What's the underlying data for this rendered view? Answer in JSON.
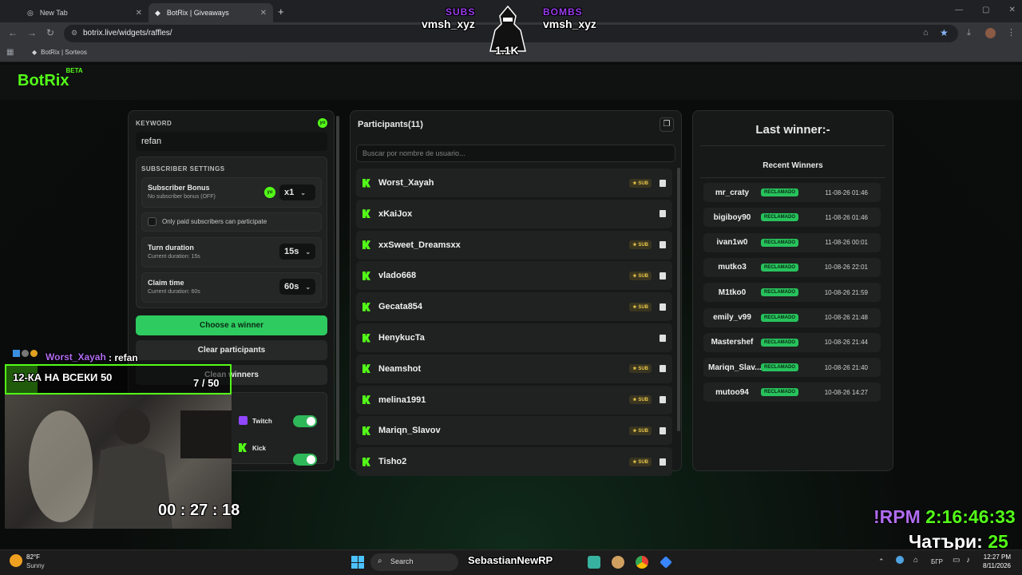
{
  "browser": {
    "tabs": [
      {
        "label": "New Tab"
      },
      {
        "label": "BotRix | Giveaways"
      }
    ],
    "url": "botrix.live/widgets/raffles/",
    "bookmark": "BotRix | Sorteos"
  },
  "overlay_top": {
    "subs_label": "SUBS",
    "subs_name": "vmsh_xyz",
    "bombs_label": "BOMBS",
    "bombs_name": "vmsh_xyz",
    "count": "1.1K"
  },
  "app": {
    "logo": "BotRix",
    "beta": "BETA"
  },
  "settings": {
    "keyword_label": "KEYWORD",
    "keyword_value": "refan",
    "sub_settings_label": "SUBSCRIBER SETTINGS",
    "bonus_title": "Subscriber Bonus",
    "bonus_sub": "No subscriber bonus (OFF)",
    "bonus_value": "x1",
    "paid_only": "Only paid subscribers can participate",
    "turn_title": "Turn duration",
    "turn_sub": "Current duration: 15s",
    "turn_value": "15s",
    "claim_title": "Claim time",
    "claim_sub": "Current duration: 60s",
    "claim_value": "60s",
    "choose_btn": "Choose a winner",
    "clear_participants_btn": "Clear participants",
    "clear_winners_btn": "Clean winners",
    "twitch": "Twitch",
    "kick": "Kick"
  },
  "participants": {
    "title": "Participants(11)",
    "search_placeholder": "Buscar por nombre de usuario...",
    "sub_badge": "SUB",
    "rows": [
      {
        "name": "Worst_Xayah",
        "sub": true
      },
      {
        "name": "xKaiJox",
        "sub": false
      },
      {
        "name": "xxSweet_Dreamsxx",
        "sub": true
      },
      {
        "name": "vlado668",
        "sub": true
      },
      {
        "name": "Gecata854",
        "sub": true
      },
      {
        "name": "HenykucTa",
        "sub": false
      },
      {
        "name": "Neamshot",
        "sub": true
      },
      {
        "name": "melina1991",
        "sub": true
      },
      {
        "name": "Mariqn_Slavov",
        "sub": true
      },
      {
        "name": "Tisho2",
        "sub": true
      }
    ]
  },
  "winners": {
    "last_winner": "Last winner:-",
    "recent_title": "Recent Winners",
    "badge": "RECLAMADO",
    "rows": [
      {
        "name": "mr_craty",
        "date": "11-08-26 01:46"
      },
      {
        "name": "bigiboy90",
        "date": "11-08-26 01:46"
      },
      {
        "name": "ivan1w0",
        "date": "11-08-26 00:01"
      },
      {
        "name": "mutko3",
        "date": "10-08-26 22:01"
      },
      {
        "name": "M1tko0",
        "date": "10-08-26 21:59"
      },
      {
        "name": "emily_v99",
        "date": "10-08-26 21:48"
      },
      {
        "name": "Mastershef",
        "date": "10-08-26 21:44"
      },
      {
        "name": "Mariqn_Slav...",
        "date": "10-08-26 21:40"
      },
      {
        "name": "mutoo94",
        "date": "10-08-26 14:27"
      }
    ]
  },
  "stream_overlay": {
    "chat_user": "Worst_Xayah",
    "chat_msg": ": refan",
    "goal_text": "12-КА НА ВСЕКИ 50",
    "goal_count": "7 / 50",
    "goal_progress": 0.14,
    "timer": "00 : 27 : 18",
    "rpm_label": "!RPM",
    "rpm_time": "2:16:46:33",
    "day_label": "Чатъри:",
    "day_value": "25"
  },
  "taskbar": {
    "weather_temp": "82°F",
    "weather_desc": "Sunny",
    "search": "Search",
    "streamer": "SebastianNewRP",
    "lang": "БГР",
    "time": "12:27 PM",
    "date": "8/11/2026"
  },
  "colors": {
    "accent": "#53fc18",
    "button": "#2ecc60",
    "badge": "#27c25c"
  }
}
